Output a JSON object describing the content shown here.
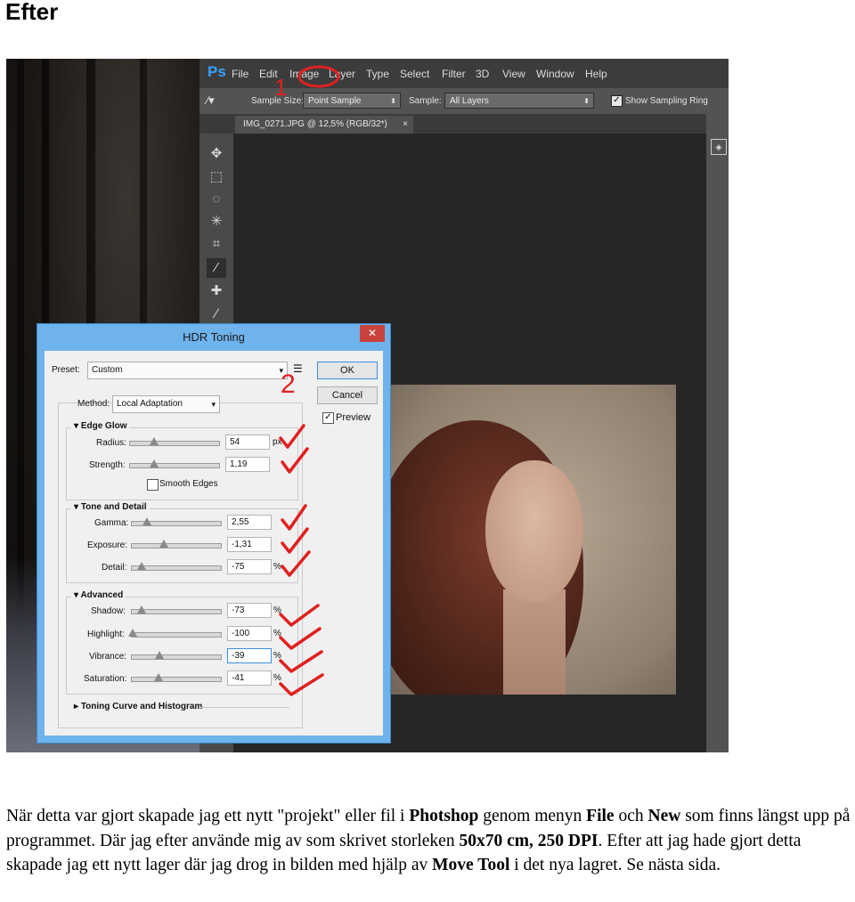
{
  "heading": "Efter",
  "photoshop": {
    "logo": "Ps",
    "menu": [
      "File",
      "Edit",
      "Image",
      "Layer",
      "Type",
      "Select",
      "Filter",
      "3D",
      "View",
      "Window",
      "Help"
    ],
    "options": {
      "sample_size_label": "Sample Size:",
      "sample_size_value": "Point Sample",
      "sample_label": "Sample:",
      "sample_value": "All Layers",
      "show_ring_label": "Show Sampling Ring"
    },
    "doc_tab": "IMG_0271.JPG @ 12,5% (RGB/32*)",
    "doc_tab_close": "×"
  },
  "dialog": {
    "title": "HDR Toning",
    "close": "✕",
    "preset_label": "Preset:",
    "preset_value": "Custom",
    "ok": "OK",
    "cancel": "Cancel",
    "preview_label": "Preview",
    "method_label": "Method:",
    "method_value": "Local Adaptation",
    "edge_glow": {
      "title": "Edge Glow",
      "radius_label": "Radius:",
      "radius_value": "54",
      "radius_unit": "px",
      "strength_label": "Strength:",
      "strength_value": "1,19",
      "smooth_edges_label": "Smooth Edges"
    },
    "tone_detail": {
      "title": "Tone and Detail",
      "gamma_label": "Gamma:",
      "gamma_value": "2,55",
      "exposure_label": "Exposure:",
      "exposure_value": "-1,31",
      "detail_label": "Detail:",
      "detail_value": "-75",
      "detail_unit": "%"
    },
    "advanced": {
      "title": "Advanced",
      "shadow_label": "Shadow:",
      "shadow_value": "-73",
      "highlight_label": "Highlight:",
      "highlight_value": "-100",
      "vibrance_label": "Vibrance:",
      "vibrance_value": "-39",
      "saturation_label": "Saturation:",
      "saturation_value": "-41",
      "unit": "%"
    },
    "toning_curve_label": "Toning Curve and Histogram"
  },
  "annotations": {
    "number_1": "1",
    "number_2": "2"
  },
  "paragraph": {
    "t1": "När detta var gjort skapade jag ett nytt \"projekt\" eller fil i ",
    "b1": "Photshop",
    "t2": " genom menyn ",
    "b2": "File",
    "t3": " och ",
    "b3": "New",
    "t4": " som finns längst upp på programmet. Där jag efter använde mig av som skrivet storleken ",
    "b4": "50x70 cm, 250 DPI",
    "t5": ". Efter att jag hade gjort detta skapade jag ett nytt lager där jag drog in bilden med hjälp av ",
    "b5": "Move Tool",
    "t6": " i det nya lagret. Se nästa sida."
  }
}
